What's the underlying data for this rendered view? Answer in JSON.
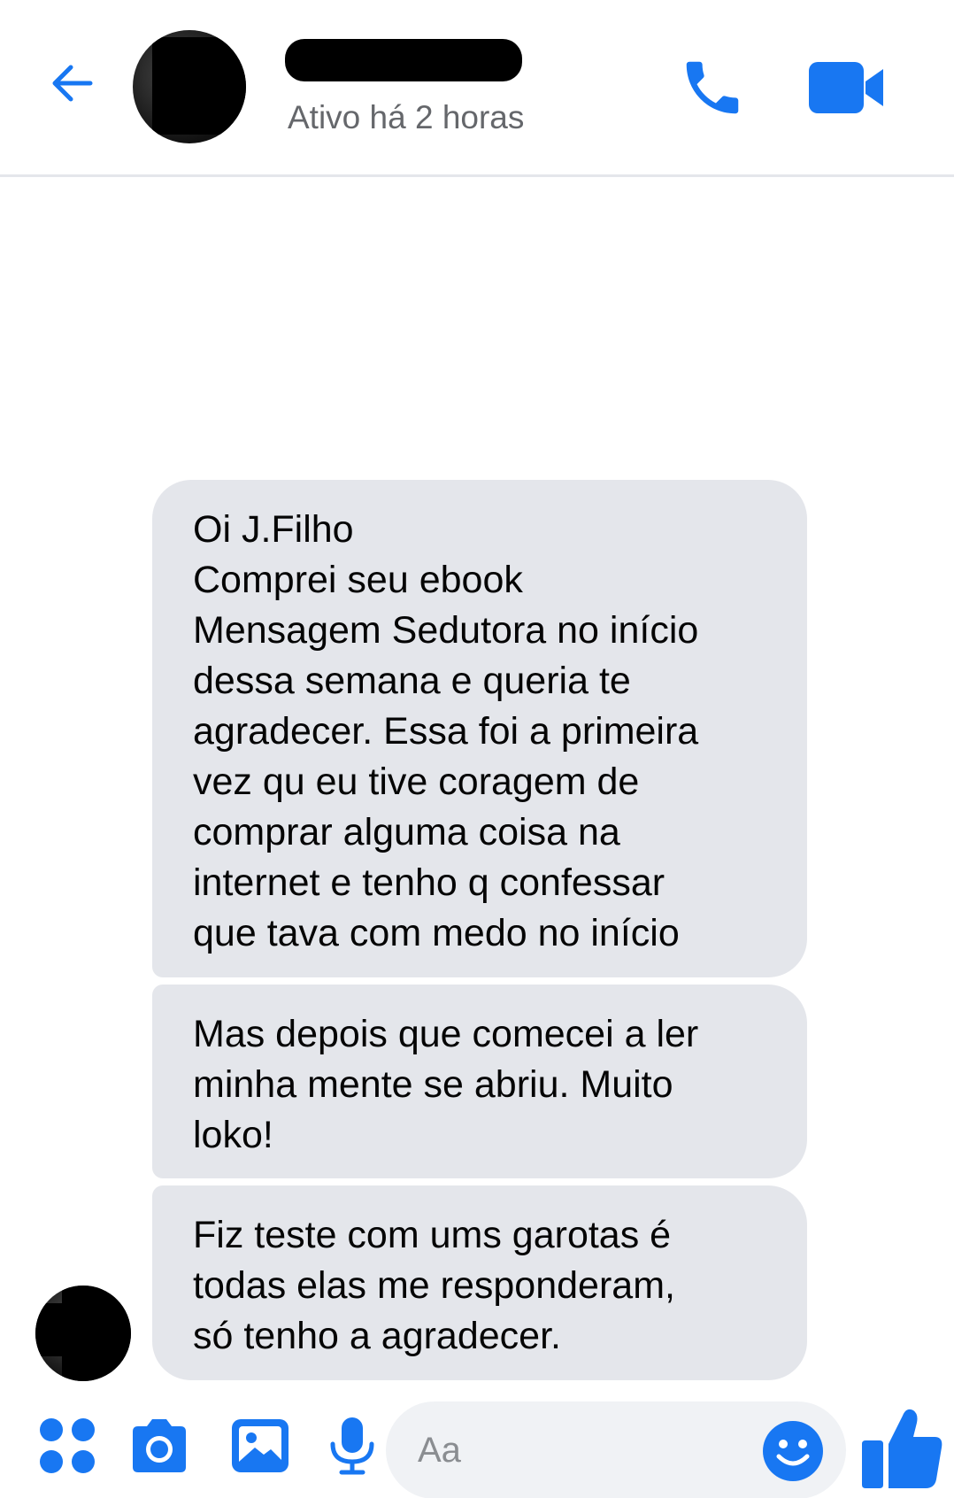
{
  "header": {
    "status": "Ativo há 2 horas"
  },
  "messages": [
    {
      "text": "Oi J.Filho\nComprei seu ebook\nMensagem Sedutora no início\ndessa semana e queria te\nagradecer. Essa foi a primeira\nvez qu eu tive coragem de\ncomprar alguma coisa na\ninternet e tenho q confessar\nque tava com medo no início"
    },
    {
      "text": "Mas depois que comecei a ler\nminha mente se abriu. Muito\nloko!"
    },
    {
      "text": "Fiz teste com ums garotas é\ntodas elas me responderam,\nsó tenho a agradecer."
    }
  ],
  "composer": {
    "placeholder": "Aa"
  },
  "colors": {
    "accent": "#1877f2",
    "bubble": "#e4e6eb",
    "status_text": "#65676b"
  },
  "icons": [
    "back-arrow-icon",
    "phone-icon",
    "video-camera-icon",
    "more-apps-icon",
    "camera-icon",
    "gallery-icon",
    "microphone-icon",
    "emoji-icon",
    "thumbs-up-icon"
  ]
}
